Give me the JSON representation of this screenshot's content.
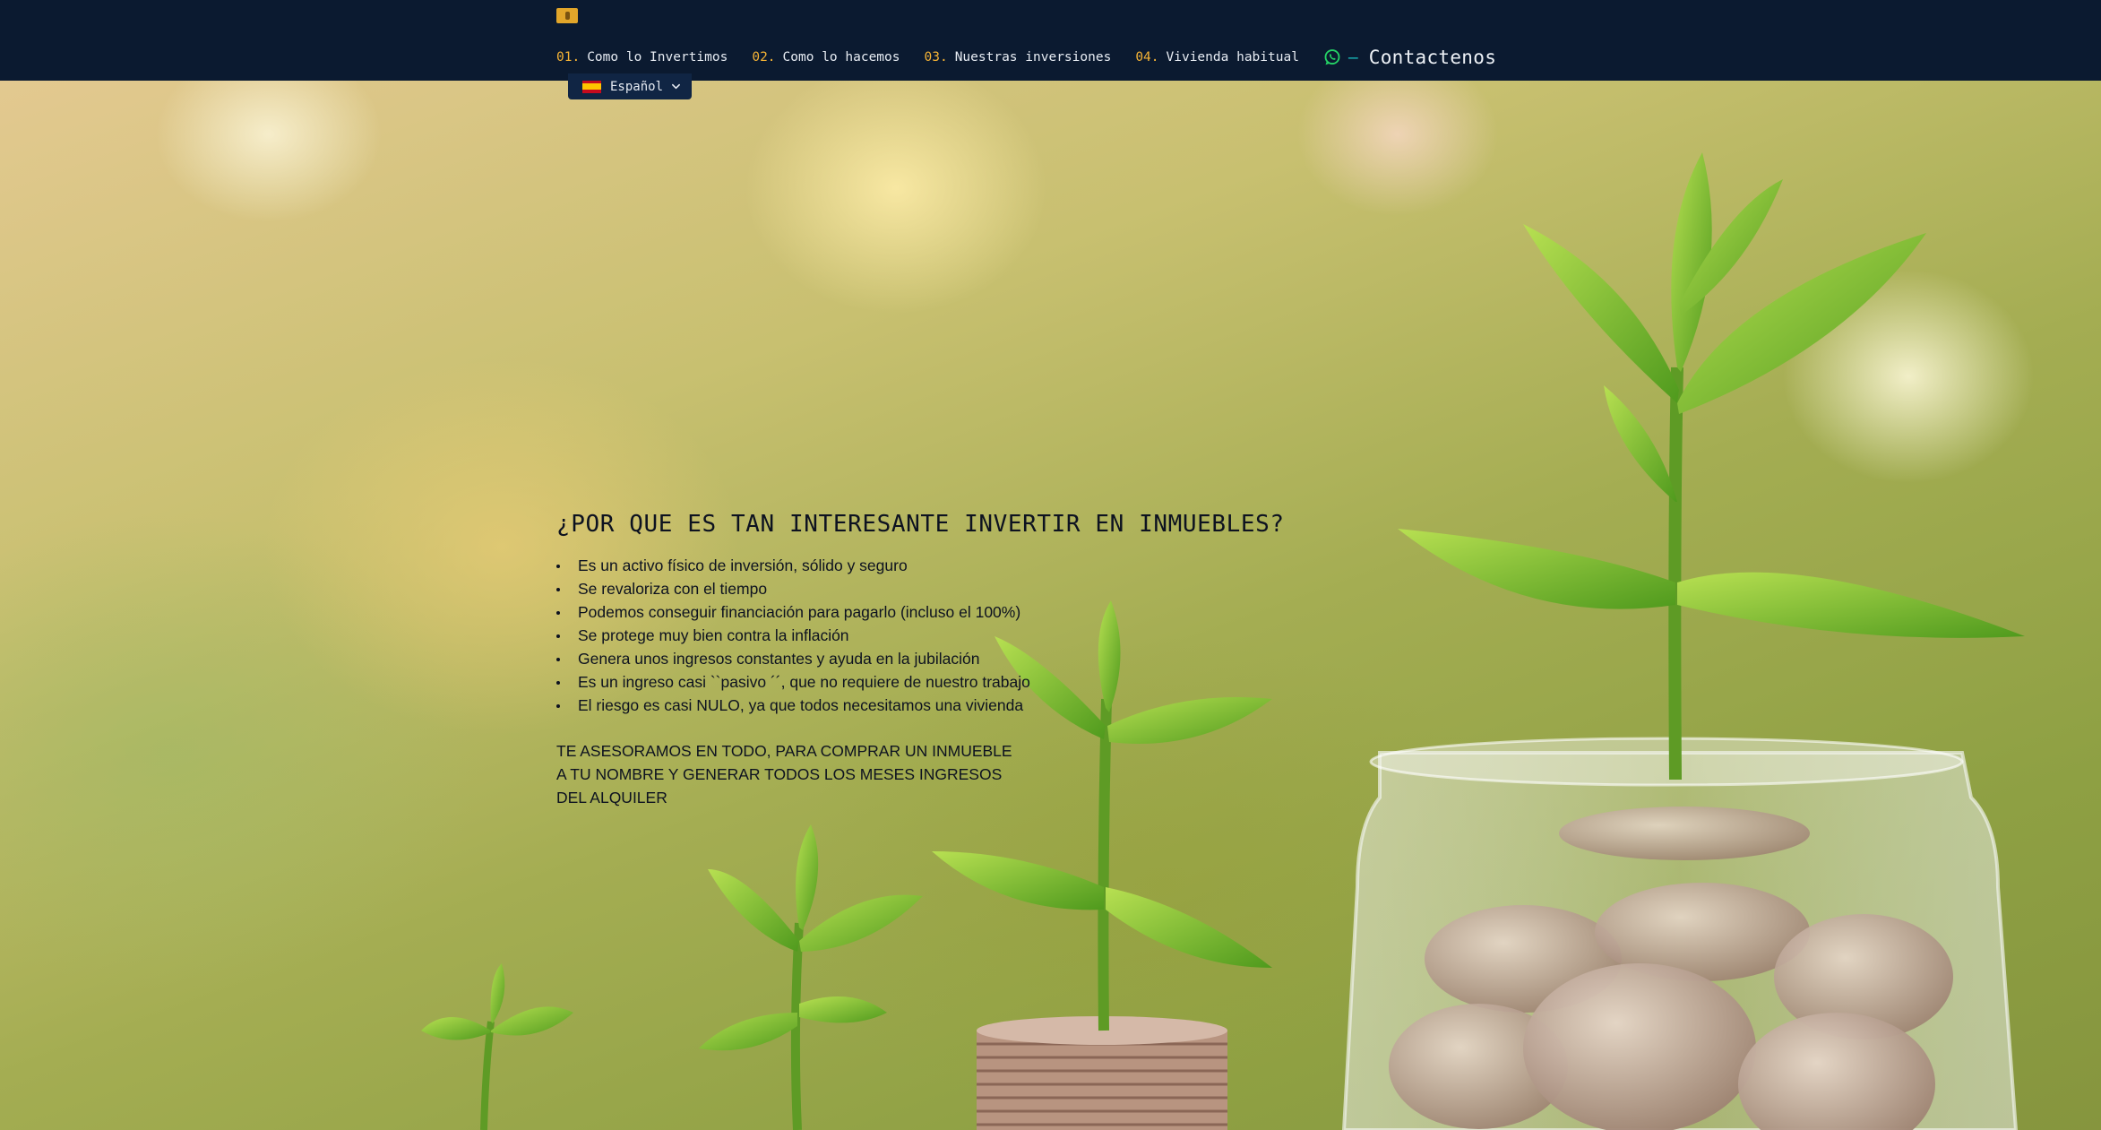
{
  "header": {
    "nav": [
      {
        "num": "01.",
        "label": "Como lo Invertimos"
      },
      {
        "num": "02.",
        "label": "Como lo hacemos"
      },
      {
        "num": "03.",
        "label": "Nuestras inversiones"
      },
      {
        "num": "04.",
        "label": "Vivienda habitual"
      }
    ],
    "contact": {
      "dash": "—",
      "label": "Contactenos",
      "icon": "whatsapp-icon"
    },
    "language": {
      "flag": "spain-flag-icon",
      "label": "Español"
    }
  },
  "hero": {
    "heading": "¿POR QUE ES TAN INTERESANTE INVERTIR EN INMUEBLES?",
    "bullets": [
      "Es un activo físico de inversión, sólido y seguro",
      "Se revaloriza con el tiempo",
      "Podemos conseguir financiación para pagarlo (incluso el 100%)",
      "Se protege muy bien contra la inflación",
      "Genera unos ingresos constantes y ayuda en la jubilación",
      "Es un ingreso casi ``pasivo ´´, que no requiere de nuestro trabajo",
      "El riesgo es casi NULO, ya que todos necesitamos una vivienda"
    ],
    "tagline": "TE ASESORAMOS EN TODO, PARA COMPRAR UN INMUEBLE A TU NOMBRE Y GENERAR TODOS LOS MESES INGRESOS DEL ALQUILER"
  },
  "colors": {
    "header_bg": "#0b1a30",
    "accent": "#f5b335",
    "whatsapp": "#25d366",
    "dash": "#19c8c8"
  }
}
